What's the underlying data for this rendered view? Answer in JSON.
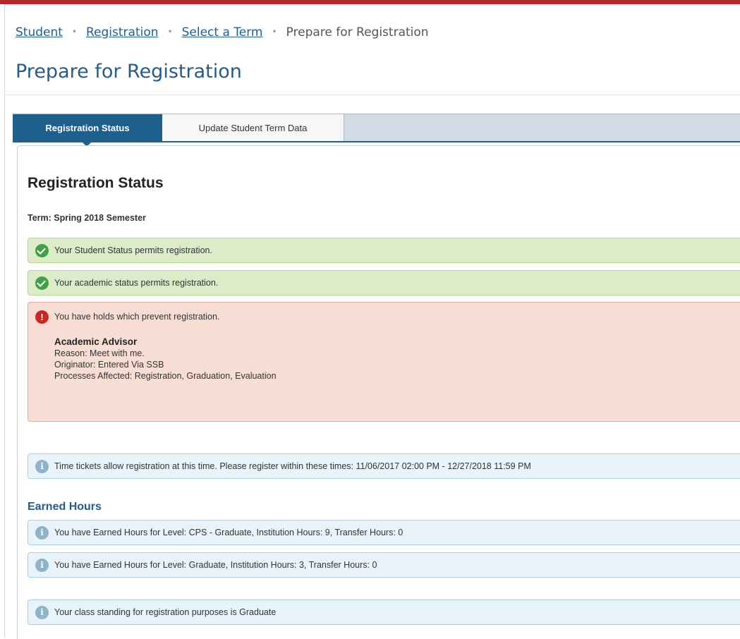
{
  "breadcrumb": {
    "items": [
      "Student",
      "Registration",
      "Select a Term"
    ],
    "current": "Prepare for Registration",
    "separator": "•"
  },
  "page": {
    "title": "Prepare for Registration"
  },
  "tabs": [
    {
      "label": "Registration Status",
      "active": true
    },
    {
      "label": "Update Student Term Data",
      "active": false
    }
  ],
  "status": {
    "heading": "Registration Status",
    "term": "Term: Spring 2018 Semester",
    "messages": {
      "student_status": "Your Student Status permits registration.",
      "academic_status": "Your academic status permits registration.",
      "holds": "You have holds which prevent registration.",
      "time_tickets": "Time tickets allow registration at this time. Please register within these times: 11/06/2017 02:00 PM - 12/27/2018 11:59 PM",
      "class_standing": "Your class standing for registration purposes is Graduate"
    },
    "hold": {
      "title": "Academic Advisor",
      "reason": "Reason: Meet with me.",
      "originator": "Originator: Entered Via SSB",
      "processes": "Processes Affected: Registration, Graduation, Evaluation"
    }
  },
  "earned_hours": {
    "heading": "Earned Hours",
    "items": [
      "You have Earned Hours for Level: CPS - Graduate, Institution Hours: 9, Transfer Hours: 0",
      "You have Earned Hours for Level: Graduate, Institution Hours: 3, Transfer Hours: 0"
    ]
  },
  "icons": {
    "success": "check-circle-icon",
    "error": "exclamation-circle-icon",
    "info": "info-circle-icon"
  },
  "colors": {
    "accent": "#1f5f8b",
    "top_bar": "#b5252b",
    "success_bg": "#dcebc8",
    "error_bg": "#f8ddd5",
    "info_bg": "#e8f4f9"
  }
}
